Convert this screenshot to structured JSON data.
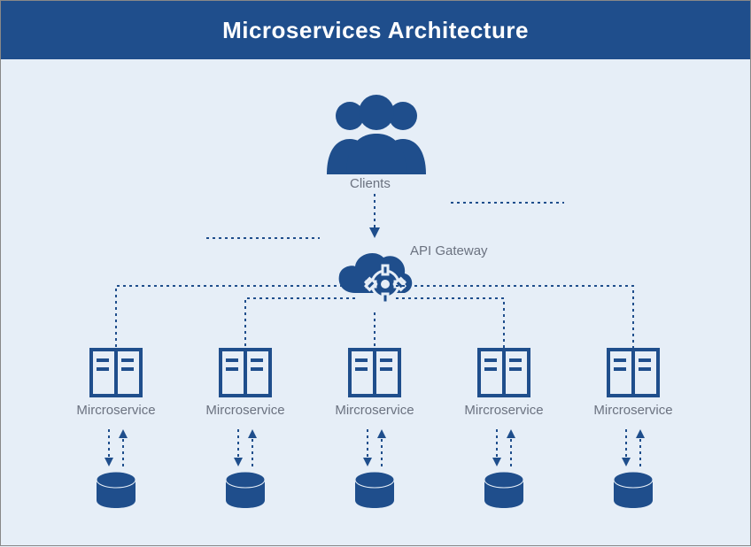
{
  "header": {
    "title": "Microservices Architecture"
  },
  "labels": {
    "clients": "Clients",
    "api_gateway": "API Gateway"
  },
  "microservices": [
    {
      "label": "Mircroservice"
    },
    {
      "label": "Mircroservice"
    },
    {
      "label": "Mircroservice"
    },
    {
      "label": "Mircroservice"
    },
    {
      "label": "Mircroservice"
    }
  ],
  "colors": {
    "header_bg": "#1f4e8c",
    "canvas_bg": "#e6eef7",
    "primary": "#1f4e8c",
    "label": "#6b7280"
  }
}
